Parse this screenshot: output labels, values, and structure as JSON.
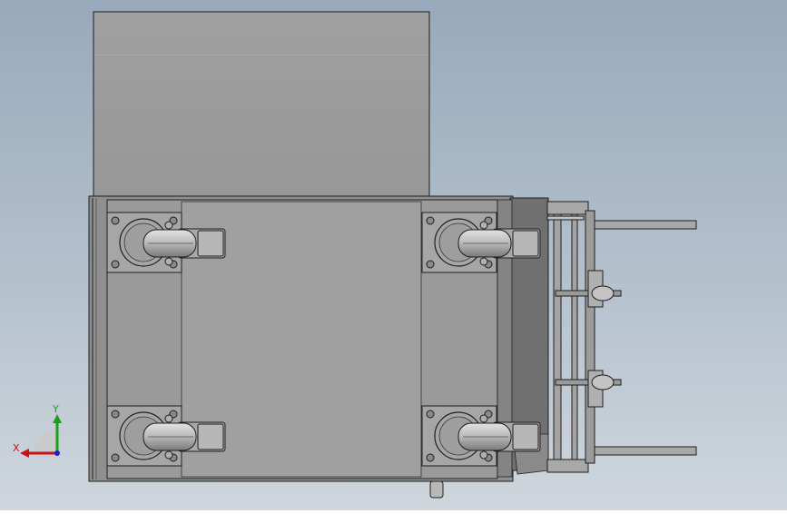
{
  "viewport": {
    "background_top": "#98a9bb",
    "background_bottom": "#cfd6dd"
  },
  "triad": {
    "x_label": "X",
    "y_label": "Y",
    "x_color": "#c81414",
    "y_color": "#18a018",
    "z_color": "#2020c8"
  },
  "model": {
    "body_color": "#9c9c9c",
    "dark_color": "#6e6e6e",
    "outline_color": "#1e1e1e",
    "caster_count": 4
  }
}
